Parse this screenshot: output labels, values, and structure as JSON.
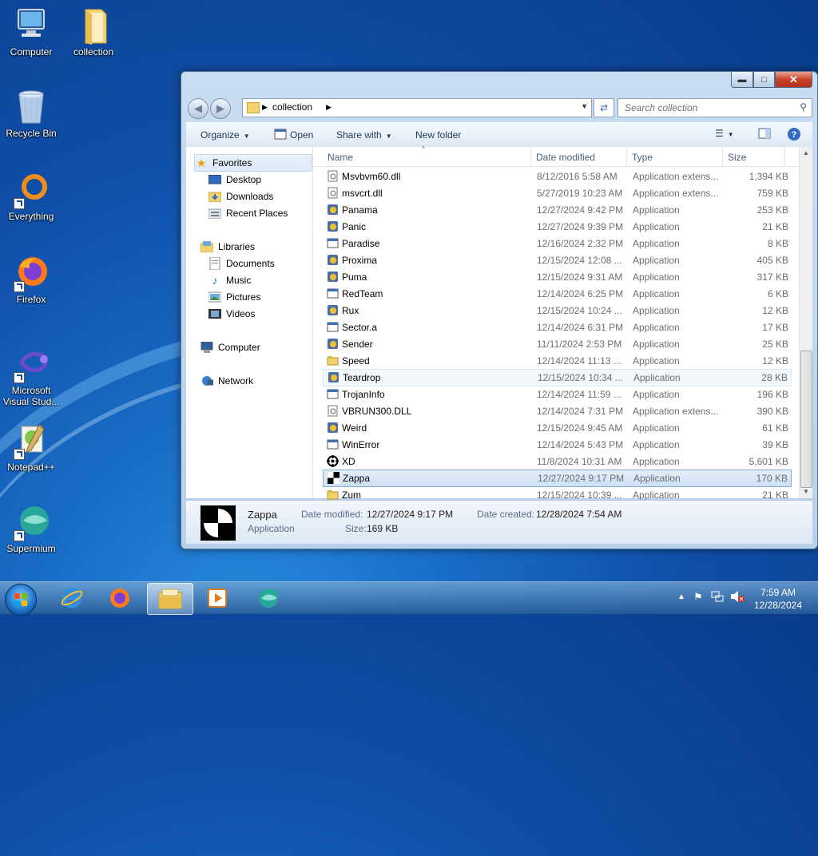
{
  "desktop": {
    "icons": [
      {
        "label": "Computer"
      },
      {
        "label": "collection"
      },
      {
        "label": "Recycle Bin"
      },
      {
        "label": "Everything"
      },
      {
        "label": "Firefox"
      },
      {
        "label": "Microsoft Visual Stud..."
      },
      {
        "label": "Notepad++"
      },
      {
        "label": "Supermium"
      }
    ]
  },
  "window": {
    "address": {
      "crumb": "collection"
    },
    "search": {
      "placeholder": "Search collection"
    },
    "toolbar": {
      "organize": "Organize",
      "open": "Open",
      "share_with": "Share with",
      "new_folder": "New folder"
    },
    "nav": {
      "favorites": "Favorites",
      "desktop": "Desktop",
      "downloads": "Downloads",
      "recent_places": "Recent Places",
      "libraries": "Libraries",
      "documents": "Documents",
      "music": "Music",
      "pictures": "Pictures",
      "videos": "Videos",
      "computer": "Computer",
      "network": "Network"
    },
    "columns": {
      "name": "Name",
      "date": "Date modified",
      "type": "Type",
      "size": "Size"
    },
    "files": [
      {
        "name": "Msvbvm60.dll",
        "date": "8/12/2016 5:58 AM",
        "type": "Application extens...",
        "size": "1,394 KB",
        "icon": "dll-icon"
      },
      {
        "name": "msvcrt.dll",
        "date": "5/27/2019 10:23 AM",
        "type": "Application extens...",
        "size": "759 KB",
        "icon": "dll-icon"
      },
      {
        "name": "Panama",
        "date": "12/27/2024 9:42 PM",
        "type": "Application",
        "size": "253 KB",
        "icon": "app-icon"
      },
      {
        "name": "Panic",
        "date": "12/27/2024 9:39 PM",
        "type": "Application",
        "size": "21 KB",
        "icon": "app-icon"
      },
      {
        "name": "Paradise",
        "date": "12/16/2024 2:32 PM",
        "type": "Application",
        "size": "8 KB",
        "icon": "window-app-icon"
      },
      {
        "name": "Proxima",
        "date": "12/15/2024 12:08 ...",
        "type": "Application",
        "size": "405 KB",
        "icon": "app-icon"
      },
      {
        "name": "Puma",
        "date": "12/15/2024 9:31 AM",
        "type": "Application",
        "size": "317 KB",
        "icon": "app-icon"
      },
      {
        "name": "RedTeam",
        "date": "12/14/2024 6:25 PM",
        "type": "Application",
        "size": "6 KB",
        "icon": "window-app-icon"
      },
      {
        "name": "Rux",
        "date": "12/15/2024 10:24 ...",
        "type": "Application",
        "size": "12 KB",
        "icon": "app-icon"
      },
      {
        "name": "Sector.a",
        "date": "12/14/2024 6:31 PM",
        "type": "Application",
        "size": "17 KB",
        "icon": "window-app-icon"
      },
      {
        "name": "Sender",
        "date": "11/11/2024 2:53 PM",
        "type": "Application",
        "size": "25 KB",
        "icon": "app-icon"
      },
      {
        "name": "Speed",
        "date": "12/14/2024 11:13 ...",
        "type": "Application",
        "size": "12 KB",
        "icon": "folder-app-icon"
      },
      {
        "name": "Teardrop",
        "date": "12/15/2024 10:34 ...",
        "type": "Application",
        "size": "28 KB",
        "icon": "app-icon"
      },
      {
        "name": "TrojanInfo",
        "date": "12/14/2024 11:59 ...",
        "type": "Application",
        "size": "196 KB",
        "icon": "window-app-icon"
      },
      {
        "name": "VBRUN300.DLL",
        "date": "12/14/2024 7:31 PM",
        "type": "Application extens...",
        "size": "390 KB",
        "icon": "dll-icon"
      },
      {
        "name": "Weird",
        "date": "12/15/2024 9:45 AM",
        "type": "Application",
        "size": "61 KB",
        "icon": "app-icon"
      },
      {
        "name": "WinError",
        "date": "12/14/2024 5:43 PM",
        "type": "Application",
        "size": "39 KB",
        "icon": "window-app-icon"
      },
      {
        "name": "XD",
        "date": "11/8/2024 10:31 AM",
        "type": "Application",
        "size": "5,601 KB",
        "icon": "target-icon"
      },
      {
        "name": "Zappa",
        "date": "12/27/2024 9:17 PM",
        "type": "Application",
        "size": "170 KB",
        "icon": "checker-icon"
      },
      {
        "name": "Zum",
        "date": "12/15/2024 10:39 ...",
        "type": "Application",
        "size": "21 KB",
        "icon": "folder-app-icon"
      }
    ],
    "details": {
      "name": "Zappa",
      "type": "Application",
      "date_modified_label": "Date modified:",
      "date_modified": "12/27/2024 9:17 PM",
      "size_label": "Size:",
      "size": "169 KB",
      "date_created_label": "Date created:",
      "date_created": "12/28/2024 7:54 AM"
    }
  },
  "taskbar": {
    "clock_time": "7:59 AM",
    "clock_date": "12/28/2024"
  }
}
